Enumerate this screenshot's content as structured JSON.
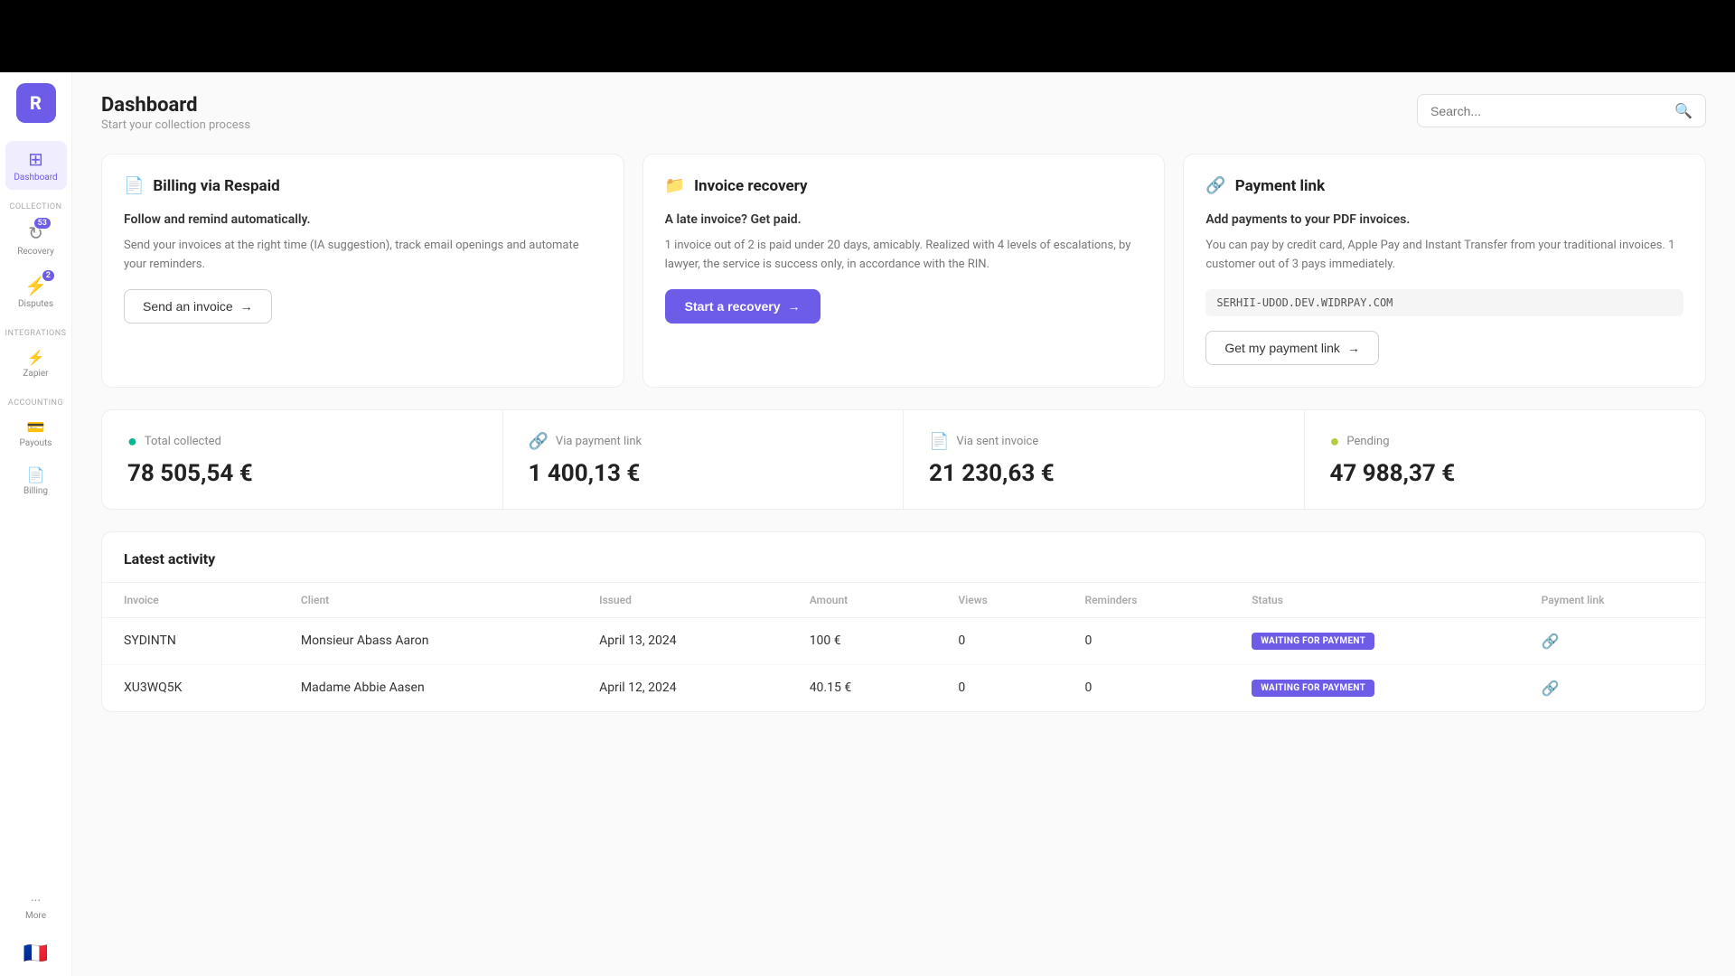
{
  "topbar": {
    "visible": true
  },
  "sidebar": {
    "logo": "R",
    "logo_bg": "#6c5ce7",
    "items": [
      {
        "id": "dashboard",
        "label": "Dashboard",
        "icon": "⊞",
        "active": true,
        "badge": null
      },
      {
        "id": "collection-label",
        "label": "COLLECTION",
        "type": "section"
      },
      {
        "id": "recovery",
        "label": "Recovery",
        "icon": "↻",
        "active": false,
        "badge": "53"
      },
      {
        "id": "disputes",
        "label": "Disputes",
        "icon": "⚡",
        "active": false,
        "badge": "2"
      },
      {
        "id": "integrations-label",
        "label": "INTEGRATIONS",
        "type": "section"
      },
      {
        "id": "zapier",
        "label": "Zapier",
        "icon": "⚡",
        "active": false,
        "badge": null
      },
      {
        "id": "accounting-label",
        "label": "ACCOUNTING",
        "type": "section"
      },
      {
        "id": "payouts",
        "label": "Payouts",
        "icon": "💳",
        "active": false,
        "badge": null
      },
      {
        "id": "billing",
        "label": "Billing",
        "icon": "📄",
        "active": false,
        "badge": null
      },
      {
        "id": "more",
        "label": "More",
        "icon": "···",
        "active": false,
        "badge": null
      }
    ],
    "flag": "🇫🇷"
  },
  "header": {
    "title": "Dashboard",
    "subtitle": "Start your collection process",
    "search_placeholder": "Search..."
  },
  "cards": [
    {
      "id": "billing-via-respaid",
      "icon": "📄",
      "title": "Billing via Respaid",
      "heading": "Follow and remind automatically.",
      "description": "Send your invoices at the right time (IA suggestion), track email openings and automate your reminders.",
      "button_label": "Send an invoice",
      "button_type": "outline",
      "url": null
    },
    {
      "id": "invoice-recovery",
      "icon": "📁",
      "title": "Invoice recovery",
      "heading": "A late invoice? Get paid.",
      "description": "1 invoice out of 2 is paid under 20 days, amicably. Realized with 4 levels of escalations, by lawyer, the service is success only, in accordance with the RIN.",
      "button_label": "Start a recovery",
      "button_type": "primary",
      "url": null
    },
    {
      "id": "payment-link",
      "icon": "🔗",
      "title": "Payment link",
      "heading": "Add payments to your PDF invoices.",
      "description": "You can pay by credit card, Apple Pay and Instant Transfer from your traditional invoices. 1 customer out of 3 pays immediately.",
      "url": "SERHII-UDOD.DEV.WIDRPAY.COM",
      "button_label": "Get my payment link",
      "button_type": "outline"
    }
  ],
  "stats": [
    {
      "id": "total-collected",
      "icon": "💚",
      "icon_type": "green",
      "label": "Total collected",
      "value": "78 505,54 €"
    },
    {
      "id": "via-payment-link",
      "icon": "🔗",
      "icon_type": "purple",
      "label": "Via payment link",
      "value": "1 400,13 €"
    },
    {
      "id": "via-sent-invoice",
      "icon": "📄",
      "icon_type": "blue",
      "label": "Via sent invoice",
      "value": "21 230,63 €"
    },
    {
      "id": "pending",
      "icon": "🟡",
      "icon_type": "yellow-green",
      "label": "Pending",
      "value": "47 988,37 €"
    }
  ],
  "activity": {
    "title": "Latest activity",
    "columns": [
      "Invoice",
      "Client",
      "Issued",
      "Amount",
      "Views",
      "Reminders",
      "Status",
      "Payment link"
    ],
    "rows": [
      {
        "invoice": "SYDINTN",
        "client": "Monsieur Abass Aaron",
        "issued": "April 13, 2024",
        "amount": "100 €",
        "views": "0",
        "reminders": "0",
        "status": "WAITING FOR PAYMENT",
        "has_link": true
      },
      {
        "invoice": "XU3WQ5K",
        "client": "Madame Abbie Aasen",
        "issued": "April 12, 2024",
        "amount": "40.15 €",
        "views": "0",
        "reminders": "0",
        "status": "WAITING FOR PAYMENT",
        "has_link": true
      }
    ]
  }
}
